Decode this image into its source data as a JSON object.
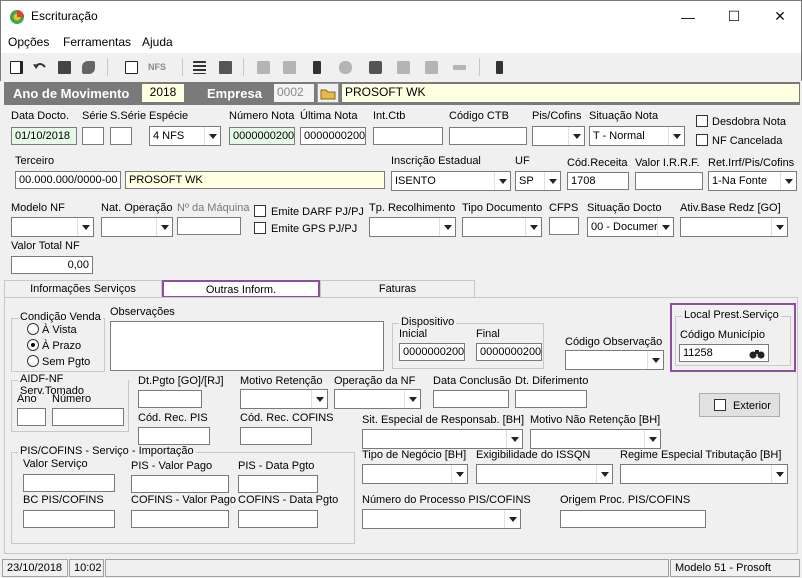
{
  "window": {
    "title": "Escrituração",
    "minimize": "—",
    "maximize": "☐",
    "close": "✕"
  },
  "menu": [
    "Opções",
    "Ferramentas",
    "Ajuda"
  ],
  "header": {
    "ano_label": "Ano de Movimento",
    "ano_value": "2018",
    "empresa_label": "Empresa",
    "empresa_code": "0002",
    "empresa_name": "PROSOFT WK"
  },
  "row1": {
    "data_docto_label": "Data Docto.",
    "data_docto": "01/10/2018",
    "serie_label": "Série",
    "sserie_label": "S.Série",
    "especie_label": "Espécie",
    "especie": "4 NFS",
    "numero_nota_label": "Número Nota",
    "numero_nota": "0000000200",
    "ultima_nota_label": "Última Nota",
    "ultima_nota": "0000000200",
    "int_ctb_label": "Int.Ctb",
    "codigo_ctb_label": "Código CTB",
    "pis_cofins_label": "Pis/Cofins",
    "situacao_nota_label": "Situação Nota",
    "situacao_nota": "T - Normal",
    "desdobra_nota_label": "Desdobra Nota",
    "nf_cancelada_label": "NF Cancelada"
  },
  "row2": {
    "terceiro_label": "Terceiro",
    "terceiro_cnpj": "00.000.000/0000-00",
    "terceiro_name": "PROSOFT WK",
    "inscricao_label": "Inscrição Estadual",
    "inscricao": "ISENTO",
    "uf_label": "UF",
    "uf": "SP",
    "cod_receita_label": "Cód.Receita",
    "cod_receita": "1708",
    "valor_irrf_label": "Valor I.R.R.F.",
    "ret_irrf_label": "Ret.Irrf/Pis/Cofins",
    "ret_irrf": "1-Na Fonte"
  },
  "row3": {
    "modelo_nf_label": "Modelo NF",
    "nat_operacao_label": "Nat. Operação",
    "n_maquina_label": "Nº da Máquina",
    "emite_darf_label": "Emite DARF PJ/PJ",
    "emite_gps_label": "Emite GPS PJ/PJ",
    "tp_recolhimento_label": "Tp. Recolhimento",
    "tipo_documento_label": "Tipo Documento",
    "cfps_label": "CFPS",
    "situacao_docto_label": "Situação Docto",
    "situacao_docto": "00 - Documer",
    "ativ_base_label": "Ativ.Base Redz [GO]"
  },
  "row4": {
    "valor_total_label": "Valor Total NF",
    "valor_total": "0,00"
  },
  "tabs": [
    "Informações Serviços",
    "Outras Inform.",
    "Faturas"
  ],
  "panel": {
    "condicao_venda": {
      "title": "Condição Venda",
      "options": [
        "À Vista",
        "À Prazo",
        "Sem Pgto"
      ],
      "selected": 1
    },
    "observacoes_label": "Observações",
    "dispositivo": {
      "title": "Dispositivo",
      "inicial_label": "Inicial",
      "inicial": "0000000200",
      "final_label": "Final",
      "final": "0000000200"
    },
    "codigo_observacao_label": "Código Observação",
    "local_prest": {
      "title": "Local Prest.Serviço",
      "codigo_municipio_label": "Código Município",
      "codigo_municipio": "11258"
    },
    "aidf": {
      "title": "AIDF-NF Serv.Tomado",
      "ano_label": "Ano",
      "numero_label": "Número"
    },
    "dt_pgto_label": "Dt.Pgto [GO]/[RJ]",
    "motivo_retencao_label": "Motivo Retenção",
    "operacao_nf_label": "Operação da NF",
    "data_conclusao_label": "Data Conclusão",
    "dt_diferimento_label": "Dt. Diferimento",
    "cod_rec_pis_label": "Cód. Rec. PIS",
    "cod_rec_cofins_label": "Cód. Rec. COFINS",
    "sit_especial_label": "Sit. Especial de Responsab. [BH]",
    "motivo_nao_retencao_label": "Motivo Não Retenção [BH]",
    "exterior_label": "Exterior",
    "pis_import": {
      "title": "PIS/COFINS - Serviço - Importação",
      "valor_servico": "Valor Serviço",
      "pis_valor_pago": "PIS - Valor Pago",
      "pis_data_pgto": "PIS - Data Pgto",
      "bc_pis": "BC PIS/COFINS",
      "cofins_valor_pago": "COFINS - Valor Pago",
      "cofins_data_pgto": "COFINS - Data Pgto"
    },
    "tipo_negocio_label": "Tipo de Negócio [BH]",
    "exigibilidade_label": "Exigibilidade do ISSQN",
    "regime_label": "Regime Especial Tributação [BH]",
    "numero_processo_label": "Número do Processo PIS/COFINS",
    "origem_proc_label": "Origem Proc. PIS/COFINS"
  },
  "status": {
    "date": "23/10/2018",
    "time": "10:02",
    "model": "Modelo 51 - Prosoft"
  },
  "colors": {
    "highlight": "#8e4f9f",
    "header_bar": "#7a7a7a",
    "field_yellow": "#ffffe1",
    "field_green": "#e6f8e6"
  }
}
